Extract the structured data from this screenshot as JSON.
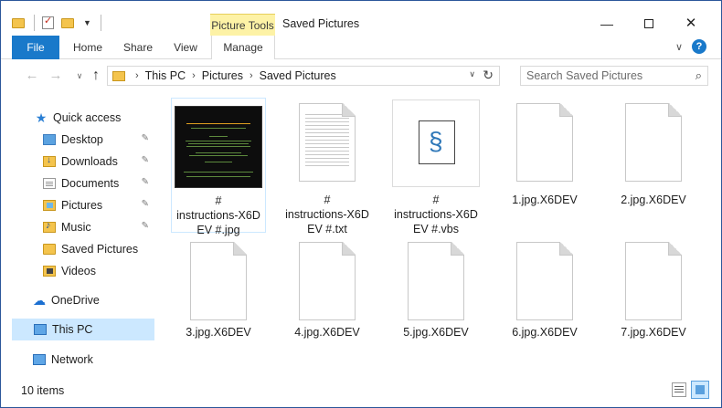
{
  "window": {
    "title": "Saved Pictures",
    "contextual_tab_group": "Picture Tools",
    "minimize_glyph": "—",
    "close_glyph": "✕"
  },
  "ribbon": {
    "tabs": [
      {
        "label": "File"
      },
      {
        "label": "Home"
      },
      {
        "label": "Share"
      },
      {
        "label": "View"
      },
      {
        "label": "Manage"
      }
    ],
    "expand_glyph": "∨",
    "help_glyph": "?"
  },
  "navigation": {
    "back_glyph": "←",
    "forward_glyph": "→",
    "recent_glyph": "∨",
    "up_glyph": "↑"
  },
  "address": {
    "crumbs": [
      "This PC",
      "Pictures",
      "Saved Pictures"
    ],
    "separator": "›",
    "dropdown_glyph": "∨",
    "refresh_glyph": "↻"
  },
  "search": {
    "placeholder": "Search Saved Pictures",
    "icon_glyph": "⌕"
  },
  "nav_pane": {
    "pin_glyph": "✎",
    "items": [
      {
        "label": "Quick access",
        "icon": "star-icon"
      },
      {
        "label": "Desktop",
        "icon": "desktop-folder-icon",
        "pinned": true
      },
      {
        "label": "Downloads",
        "icon": "downloads-folder-icon",
        "pinned": true
      },
      {
        "label": "Documents",
        "icon": "documents-folder-icon",
        "pinned": true
      },
      {
        "label": "Pictures",
        "icon": "pictures-folder-icon",
        "pinned": true
      },
      {
        "label": "Music",
        "icon": "music-folder-icon",
        "pinned": true
      },
      {
        "label": "Saved Pictures",
        "icon": "folder-icon"
      },
      {
        "label": "Videos",
        "icon": "videos-folder-icon"
      },
      {
        "label": "OneDrive",
        "icon": "onedrive-icon"
      },
      {
        "label": "This PC",
        "icon": "computer-icon",
        "selected": true
      },
      {
        "label": "Network",
        "icon": "network-icon"
      }
    ]
  },
  "files": [
    {
      "name": "#\ninstructions-X6DEV #.jpg",
      "line1": "#",
      "line2": "instructions-X6D",
      "line3": "EV #.jpg",
      "type": "image",
      "selected": true
    },
    {
      "name": "#\ninstructions-X6DEV #.txt",
      "line1": "#",
      "line2": "instructions-X6D",
      "line3": "EV #.txt",
      "type": "text"
    },
    {
      "name": "#\ninstructions-X6DEV #.vbs",
      "line1": "#",
      "line2": "instructions-X6D",
      "line3": "EV #.vbs",
      "type": "script"
    },
    {
      "name": "1.jpg.X6DEV",
      "line1": "1.jpg.X6DEV",
      "type": "blank"
    },
    {
      "name": "2.jpg.X6DEV",
      "line1": "2.jpg.X6DEV",
      "type": "blank"
    },
    {
      "name": "3.jpg.X6DEV",
      "line1": "3.jpg.X6DEV",
      "type": "blank"
    },
    {
      "name": "4.jpg.X6DEV",
      "line1": "4.jpg.X6DEV",
      "type": "blank"
    },
    {
      "name": "5.jpg.X6DEV",
      "line1": "5.jpg.X6DEV",
      "type": "blank"
    },
    {
      "name": "6.jpg.X6DEV",
      "line1": "6.jpg.X6DEV",
      "type": "blank"
    },
    {
      "name": "7.jpg.X6DEV",
      "line1": "7.jpg.X6DEV",
      "type": "blank"
    }
  ],
  "status": {
    "item_count": "10 items"
  },
  "colors": {
    "accent": "#1979ca",
    "selection": "#cce8ff",
    "picture_tools": "#fdf2a6",
    "folder": "#f4c44d"
  }
}
